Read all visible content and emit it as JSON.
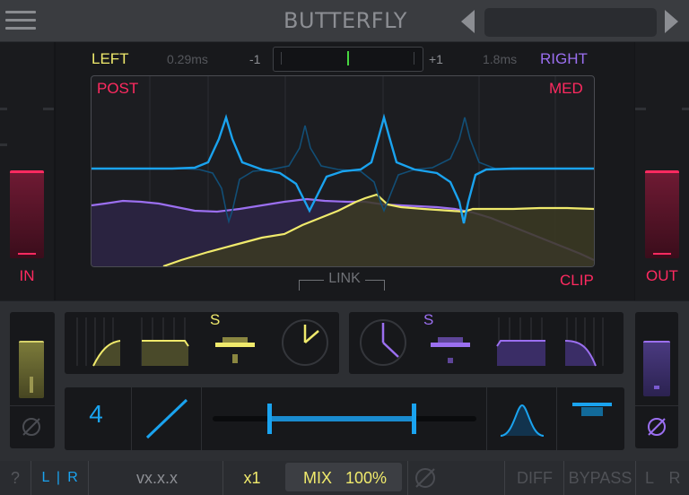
{
  "header": {
    "title": "BUTTERFLY",
    "menu_icon": "hamburger-menu-icon",
    "prev_icon": "triangle-left-icon",
    "next_icon": "triangle-right-icon",
    "preset_name": ""
  },
  "graph": {
    "left_label": "LEFT",
    "left_delay": "0.29ms",
    "balance_min": "-1",
    "balance_max": "+1",
    "right_delay": "1.8ms",
    "right_label": "RIGHT",
    "post_label": "POST",
    "med_label": "MED",
    "link_label": "LINK",
    "clip_label": "CLIP",
    "in_label": "IN",
    "out_label": "OUT"
  },
  "controls": {
    "left_s_label": "S",
    "right_s_label": "S",
    "band_count": "4"
  },
  "bottombar": {
    "help_label": "?",
    "lr_left": "L",
    "lr_sep": "|",
    "lr_right": "R",
    "version": "vx.x.x",
    "oversample": "x1",
    "mix_label": "MIX",
    "mix_value": "100%",
    "diff_label": "DIFF",
    "bypass_label": "BYPASS",
    "l_label": "L",
    "r_label": "R"
  },
  "colors": {
    "left": "#f0ea6c",
    "right": "#9b6ff0",
    "accent_red": "#ff2a60",
    "blue": "#1aa3ef"
  }
}
